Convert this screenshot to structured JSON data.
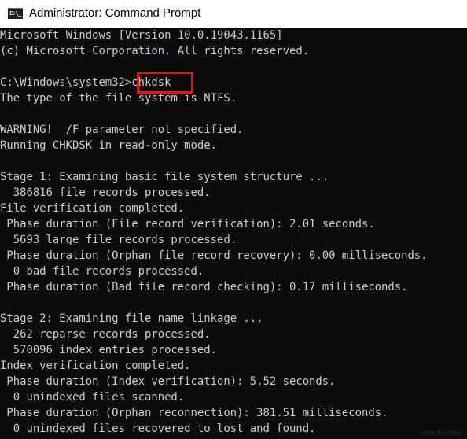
{
  "window": {
    "title": "Administrator: Command Prompt",
    "icon": "cmd-icon",
    "icon_label": "C:\\_"
  },
  "console": {
    "background": "#0c0c0c",
    "foreground": "#cccccc",
    "lines": [
      "Microsoft Windows [Version 10.0.19043.1165]",
      "(c) Microsoft Corporation. All rights reserved.",
      "",
      "C:\\Windows\\system32>chkdsk",
      "The type of the file system is NTFS.",
      "",
      "WARNING!  /F parameter not specified.",
      "Running CHKDSK in read-only mode.",
      "",
      "Stage 1: Examining basic file system structure ...",
      "  386816 file records processed.",
      "File verification completed.",
      " Phase duration (File record verification): 2.01 seconds.",
      "  5693 large file records processed.",
      " Phase duration (Orphan file record recovery): 0.00 milliseconds.",
      "  0 bad file records processed.",
      " Phase duration (Bad file record checking): 0.17 milliseconds.",
      "",
      "Stage 2: Examining file name linkage ...",
      "  262 reparse records processed.",
      "  570096 index entries processed.",
      "Index verification completed.",
      " Phase duration (Index verification): 5.52 seconds.",
      "  0 unindexed files scanned.",
      " Phase duration (Orphan reconnection): 381.51 milliseconds.",
      "  0 unindexed files recovered to lost and found."
    ],
    "prompt": "C:\\Windows\\system32>",
    "command": "chkdsk"
  },
  "annotation": {
    "highlight_color": "#e0161a",
    "highlighted_text": "chkdsk"
  },
  "watermark": "wsxdn.com"
}
